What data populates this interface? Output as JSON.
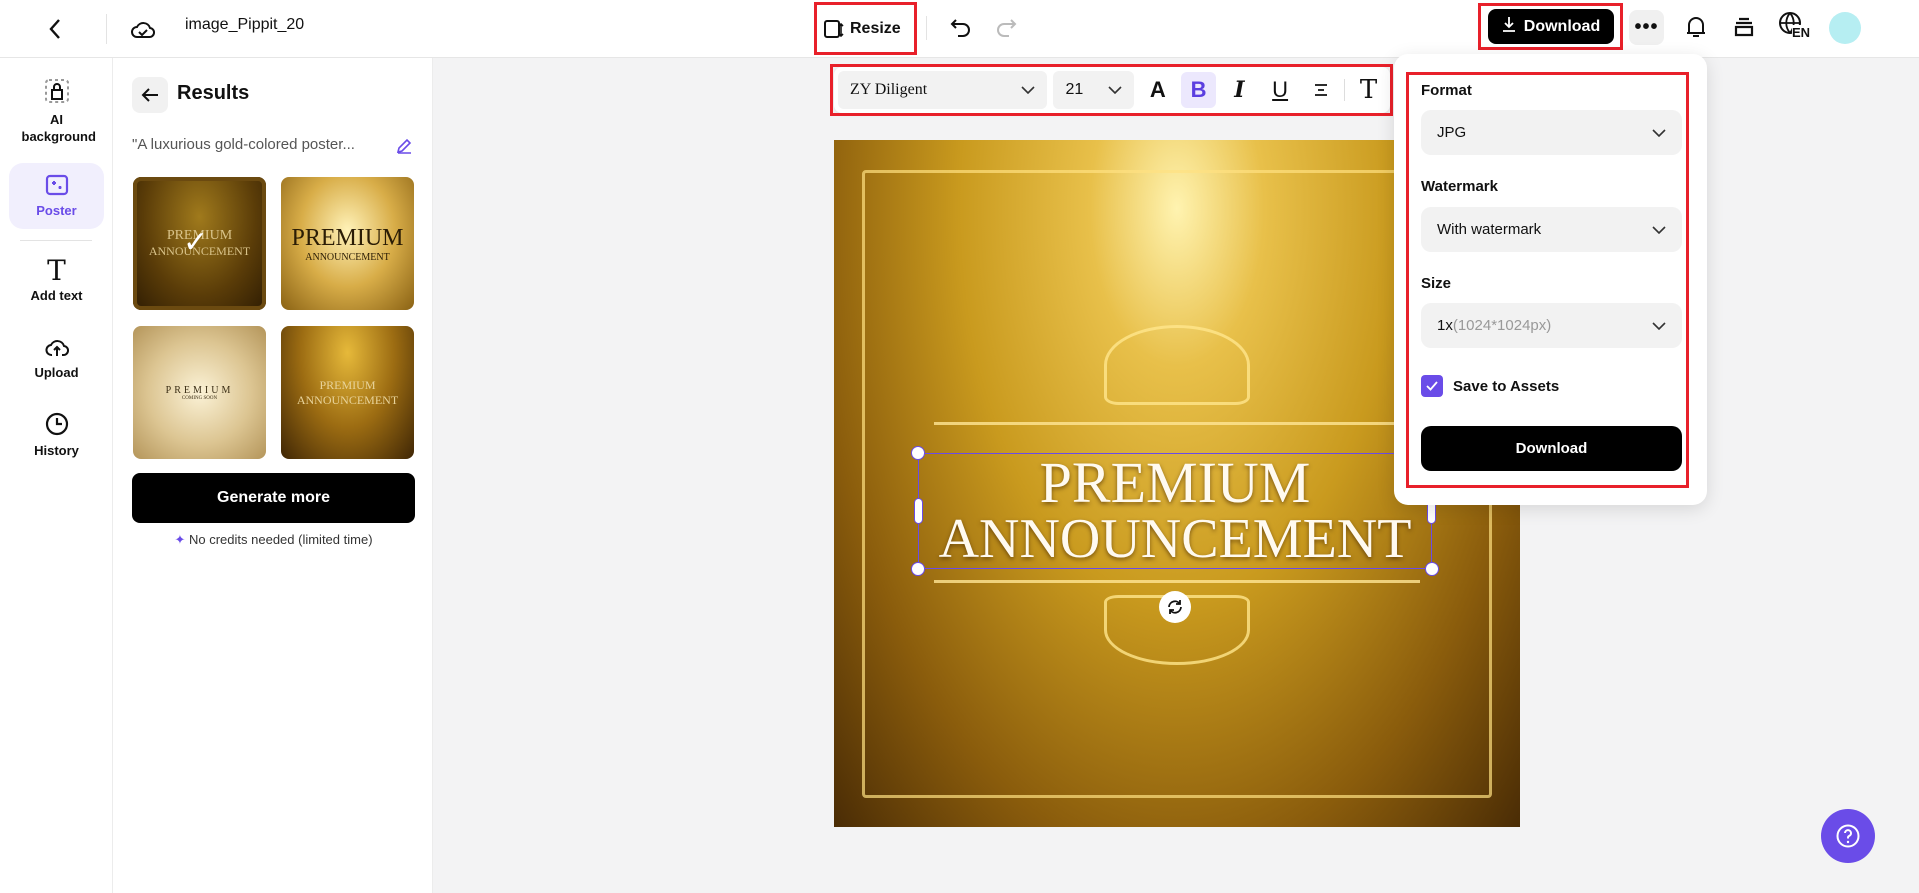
{
  "header": {
    "title": "image_Pippit_20",
    "resize_label": "Resize",
    "download_label": "Download",
    "lang": "EN"
  },
  "rail": {
    "items": [
      {
        "label": "AI background"
      },
      {
        "label": "Poster"
      },
      {
        "label": "Add text"
      },
      {
        "label": "Upload"
      },
      {
        "label": "History"
      }
    ]
  },
  "panel": {
    "title": "Results",
    "prompt": "\"A luxurious gold-colored poster...",
    "thumbs": [
      {
        "line1": "PREMIUM",
        "line2": "ANNOUNCEMENT"
      },
      {
        "line1": "PREMIUM",
        "line2": "ANNOUNCEMENT"
      },
      {
        "line1": "PREMIUM",
        "line2": "COMING SOON"
      },
      {
        "line1": "PREMIUM",
        "line2": "ANNOUNCEMENT"
      }
    ],
    "generate_label": "Generate more",
    "credits_note": "No credits needed (limited time)"
  },
  "toolbar": {
    "font": "ZY Diligent",
    "size": "21"
  },
  "canvas": {
    "line1": "PREMIUM",
    "line2": "ANNOUNCEMENT"
  },
  "download_popup": {
    "format_label": "Format",
    "format_value": "JPG",
    "watermark_label": "Watermark",
    "watermark_value": "With watermark",
    "size_label": "Size",
    "size_scale": "1x",
    "size_dims": "(1024*1024px)",
    "save_label": "Save to Assets",
    "save_checked": true,
    "download_label": "Download"
  },
  "colors": {
    "accent": "#6a4ce8",
    "highlight": "#e8202a"
  }
}
